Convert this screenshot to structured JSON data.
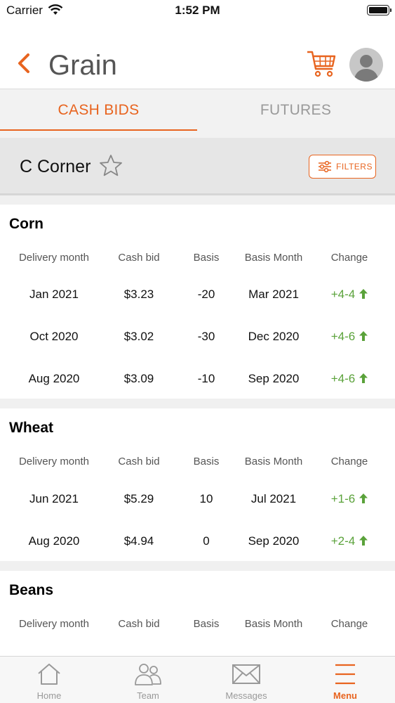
{
  "status_bar": {
    "carrier": "Carrier",
    "time": "1:52 PM"
  },
  "header": {
    "title": "Grain"
  },
  "tabs": [
    {
      "label": "CASH BIDS",
      "active": true
    },
    {
      "label": "FUTURES",
      "active": false
    }
  ],
  "location": {
    "name": "C Corner",
    "filters_label": "FILTERS"
  },
  "columns": [
    "Delivery month",
    "Cash bid",
    "Basis",
    "Basis Month",
    "Change"
  ],
  "sections": [
    {
      "title": "Corn",
      "rows": [
        {
          "delivery": "Jan 2021",
          "cash_bid": "$3.23",
          "basis": "-20",
          "basis_month": "Mar 2021",
          "change": "+4-4"
        },
        {
          "delivery": "Oct 2020",
          "cash_bid": "$3.02",
          "basis": "-30",
          "basis_month": "Dec 2020",
          "change": "+4-6"
        },
        {
          "delivery": "Aug 2020",
          "cash_bid": "$3.09",
          "basis": "-10",
          "basis_month": "Sep 2020",
          "change": "+4-6"
        }
      ]
    },
    {
      "title": "Wheat",
      "rows": [
        {
          "delivery": "Jun 2021",
          "cash_bid": "$5.29",
          "basis": "10",
          "basis_month": "Jul 2021",
          "change": "+1-6"
        },
        {
          "delivery": "Aug 2020",
          "cash_bid": "$4.94",
          "basis": "0",
          "basis_month": "Sep 2020",
          "change": "+2-4"
        }
      ]
    },
    {
      "title": "Beans",
      "rows": []
    }
  ],
  "tabbar": [
    {
      "label": "Home",
      "icon": "home-icon",
      "active": false
    },
    {
      "label": "Team",
      "icon": "team-icon",
      "active": false
    },
    {
      "label": "Messages",
      "icon": "envelope-icon",
      "active": false
    },
    {
      "label": "Menu",
      "icon": "menu-icon",
      "active": true
    }
  ],
  "colors": {
    "accent": "#e8641f",
    "positive": "#5aa23a"
  }
}
